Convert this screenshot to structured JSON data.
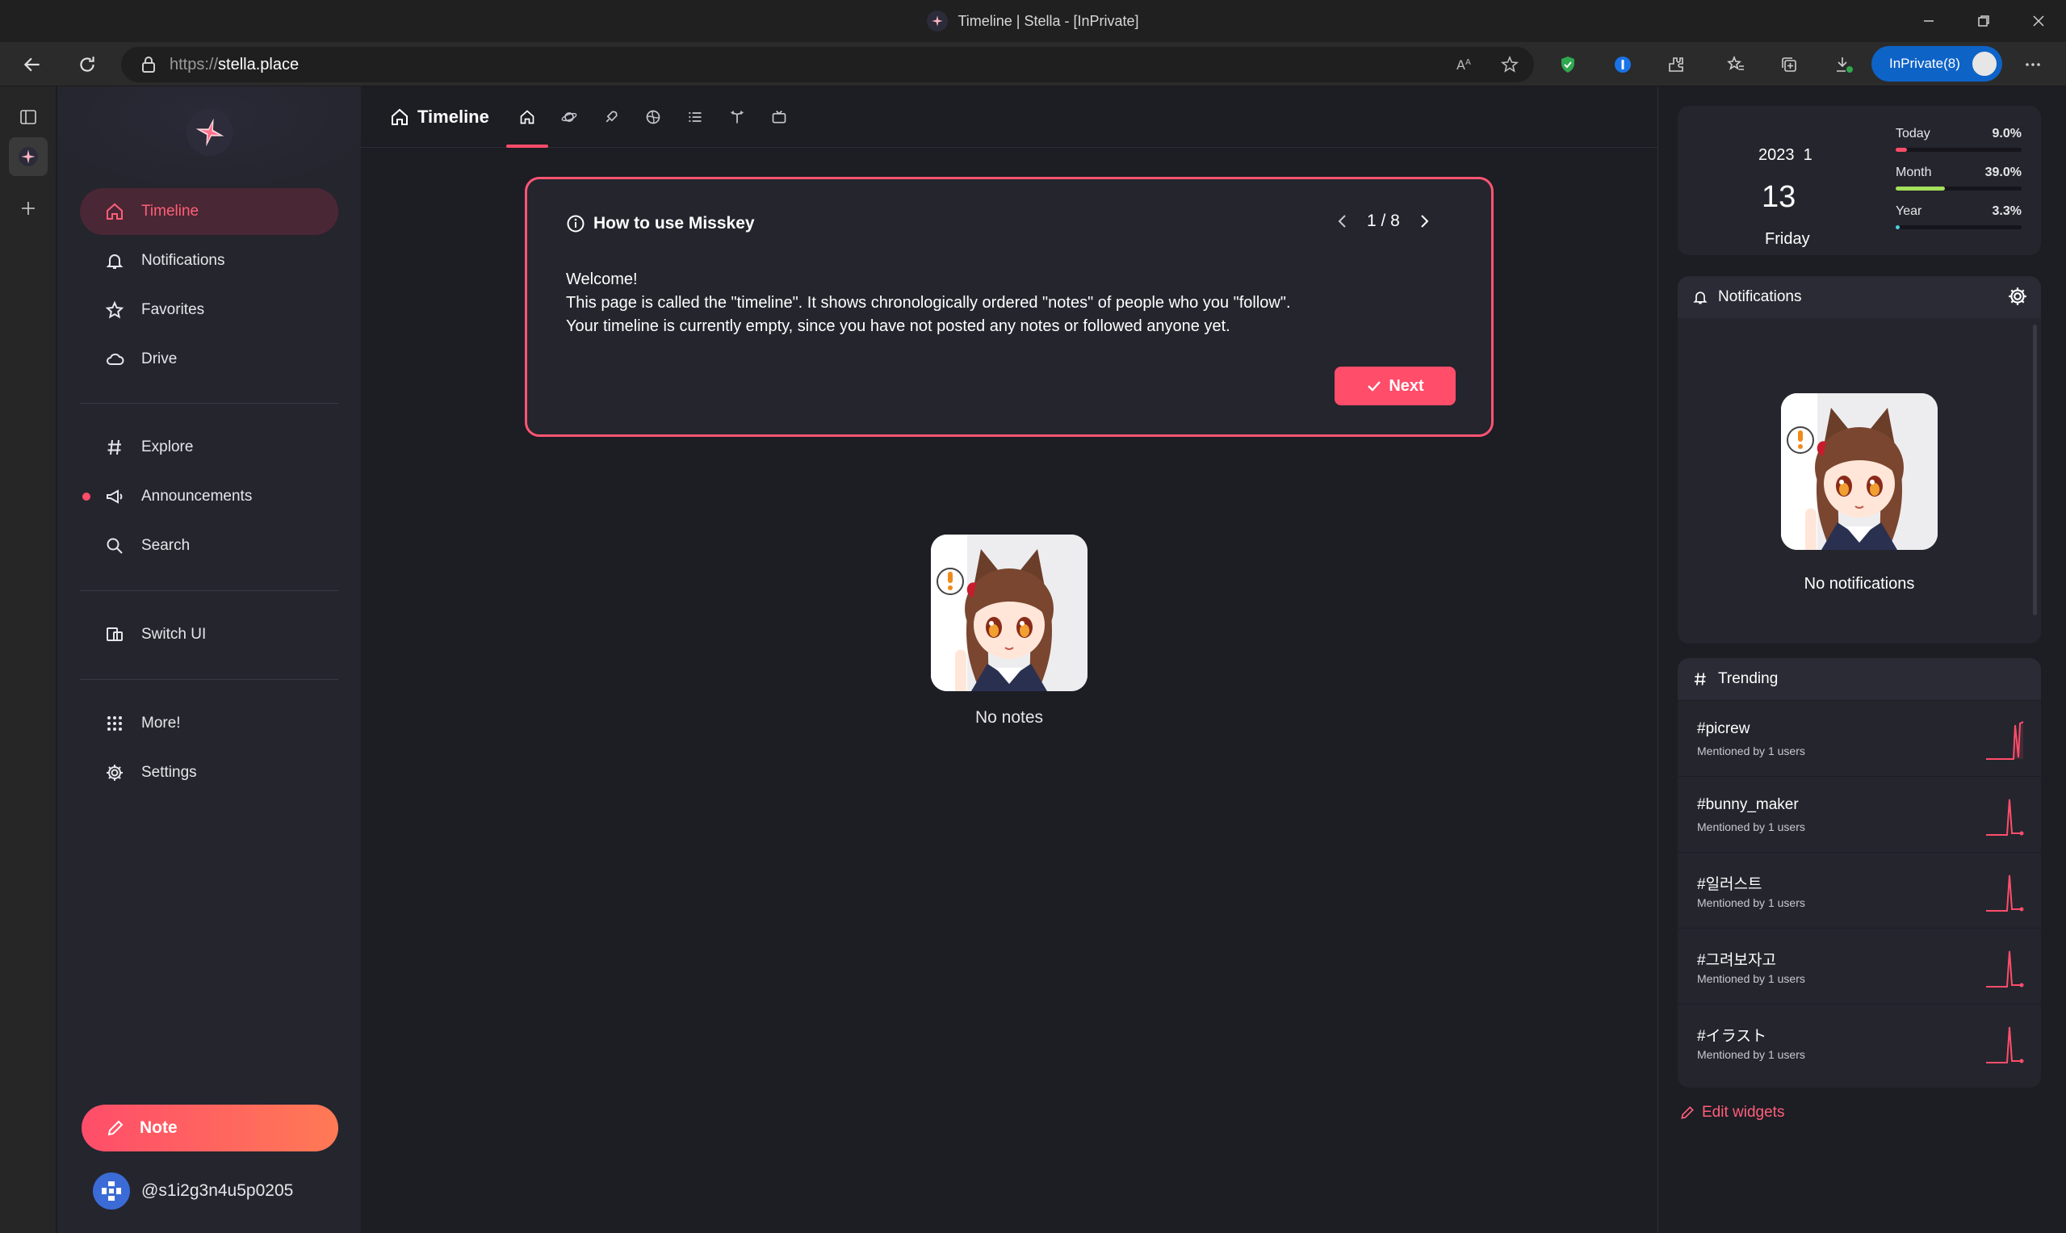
{
  "browser": {
    "window_title": "Timeline | Stella - [InPrivate]",
    "url_prefix": "https://",
    "url_host": "stella.place",
    "inprivate_label": "InPrivate(8)"
  },
  "nav": {
    "items": [
      {
        "label": "Timeline",
        "icon": "home-icon"
      },
      {
        "label": "Notifications",
        "icon": "bell-icon"
      },
      {
        "label": "Favorites",
        "icon": "star-icon"
      },
      {
        "label": "Drive",
        "icon": "cloud-icon"
      },
      {
        "label": "Explore",
        "icon": "hash-icon"
      },
      {
        "label": "Announcements",
        "icon": "speaker-icon"
      },
      {
        "label": "Search",
        "icon": "search-icon"
      },
      {
        "label": "Switch UI",
        "icon": "switch-ui-icon"
      },
      {
        "label": "More!",
        "icon": "grid-icon"
      },
      {
        "label": "Settings",
        "icon": "gear-icon"
      }
    ],
    "note_button": "Note",
    "account_handle": "@s1i2g3n4u5p0205"
  },
  "main": {
    "title": "Timeline",
    "tutorial": {
      "title": "How to use Misskey",
      "pager": "1 / 8",
      "line1": "Welcome!",
      "line2": "This page is called the \"timeline\". It shows chronologically ordered \"notes\" of people who you \"follow\".",
      "line3": "Your timeline is currently empty, since you have not posted any notes or followed anyone yet.",
      "next_label": "Next"
    },
    "empty_text": "No notes"
  },
  "widgets": {
    "calendar": {
      "year_month": "2023  1",
      "day": "13",
      "weekday": "Friday",
      "rows": [
        {
          "label": "Today",
          "percent": "9.0%",
          "value": 0.09,
          "color": "#ff4d6a"
        },
        {
          "label": "Month",
          "percent": "39.0%",
          "value": 0.39,
          "color": "#a4e05a"
        },
        {
          "label": "Year",
          "percent": "3.3%",
          "value": 0.033,
          "color": "#4fd0e0"
        }
      ]
    },
    "notifications": {
      "title": "Notifications",
      "empty_text": "No notifications"
    },
    "trending": {
      "title": "Trending",
      "items": [
        {
          "tag": "#picrew",
          "sub": "Mentioned by 1 users"
        },
        {
          "tag": "#bunny_maker",
          "sub": "Mentioned by 1 users"
        },
        {
          "tag": "#일러스트",
          "sub": "Mentioned by 1 users"
        },
        {
          "tag": "#그려보자고",
          "sub": "Mentioned by 1 users"
        },
        {
          "tag": "#イラスト",
          "sub": "Mentioned by 1 users"
        }
      ]
    },
    "edit_label": "Edit widgets"
  },
  "colors": {
    "accent": "#ff4d6a",
    "background": "#1d1d24",
    "panel": "#25252e"
  }
}
